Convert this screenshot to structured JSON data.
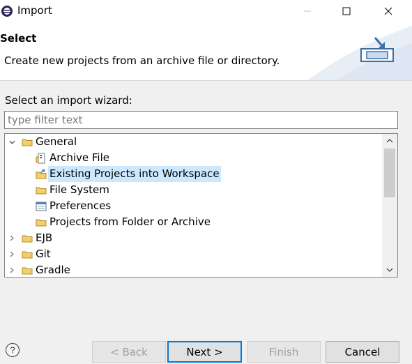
{
  "window": {
    "title": "Import",
    "controls": [
      "minimize",
      "maximize",
      "close"
    ]
  },
  "header": {
    "title": "Select",
    "description": "Create new projects from an archive file or directory.",
    "icon": "import-wizard-icon"
  },
  "content": {
    "wizard_label": "Select an import wizard:",
    "filter_placeholder": "type filter text",
    "filter_value": ""
  },
  "tree": {
    "items": [
      {
        "label": "General",
        "expanded": true,
        "level": 0,
        "icon": "folder-icon"
      },
      {
        "label": "Archive File",
        "level": 1,
        "icon": "archive-file-icon"
      },
      {
        "label": "Existing Projects into Workspace",
        "level": 1,
        "icon": "existing-projects-icon",
        "selected": true
      },
      {
        "label": "File System",
        "level": 1,
        "icon": "folder-icon"
      },
      {
        "label": "Preferences",
        "level": 1,
        "icon": "preferences-icon"
      },
      {
        "label": "Projects from Folder or Archive",
        "level": 1,
        "icon": "folder-icon"
      },
      {
        "label": "EJB",
        "expanded": false,
        "level": 0,
        "icon": "folder-icon"
      },
      {
        "label": "Git",
        "expanded": false,
        "level": 0,
        "icon": "folder-icon"
      },
      {
        "label": "Gradle",
        "expanded": false,
        "level": 0,
        "icon": "folder-icon"
      }
    ]
  },
  "buttons": {
    "back": "< Back",
    "next": "Next >",
    "finish": "Finish",
    "cancel": "Cancel"
  },
  "colors": {
    "selection": "#cce8ff",
    "default_button_border": "#0078d7",
    "folder": "#e8b94a"
  }
}
